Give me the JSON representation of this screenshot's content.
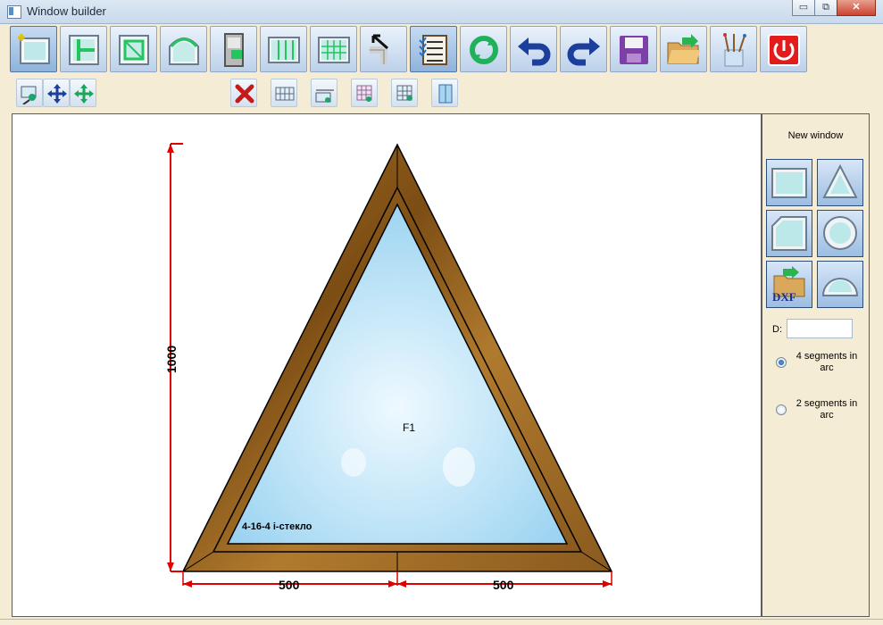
{
  "window": {
    "title": "Window builder",
    "minimize_glyph": "▭",
    "restore_glyph": "⧉",
    "close_glyph": "✕"
  },
  "toolbar_main": [
    {
      "name": "new-window-tool",
      "icon": "window-plus-icon",
      "active": true
    },
    {
      "name": "impost-tool",
      "icon": "impost-icon"
    },
    {
      "name": "sash-tool",
      "icon": "sash-icon"
    },
    {
      "name": "arc-tool",
      "icon": "arc-frame-icon"
    },
    {
      "name": "door-tool",
      "icon": "door-icon"
    },
    {
      "name": "vertical-division-tool",
      "icon": "vertical-split-icon"
    },
    {
      "name": "grid-division-tool",
      "icon": "grid-split-icon"
    },
    {
      "name": "connector-tool",
      "icon": "profile-connector-icon"
    },
    {
      "name": "properties-tool",
      "icon": "checklist-icon",
      "active": true
    },
    {
      "name": "refresh-tool",
      "icon": "refresh-icon"
    },
    {
      "name": "undo-tool",
      "icon": "undo-icon"
    },
    {
      "name": "redo-tool",
      "icon": "redo-icon"
    },
    {
      "name": "save-tool",
      "icon": "floppy-disk-icon"
    },
    {
      "name": "open-tool",
      "icon": "open-folder-icon"
    },
    {
      "name": "colors-tool",
      "icon": "brushes-icon"
    },
    {
      "name": "exit-tool",
      "icon": "power-icon"
    }
  ],
  "toolbar_secondary": [
    {
      "name": "zoom-tool",
      "icon": "zoom-icon"
    },
    {
      "name": "pan-tool",
      "icon": "move-arrows-icon"
    },
    {
      "name": "fit-tool",
      "icon": "fit-arrows-icon"
    },
    {
      "name": "delete-tool",
      "icon": "red-x-icon"
    },
    {
      "name": "glazing-bars-tool",
      "icon": "glazing-bars-icon"
    },
    {
      "name": "dimension-tool",
      "icon": "dimension-icon"
    },
    {
      "name": "mosquito-net-tool",
      "icon": "net-icon"
    },
    {
      "name": "net-search-tool",
      "icon": "net-search-icon"
    },
    {
      "name": "mirror-tool",
      "icon": "mirror-icon"
    }
  ],
  "drawing": {
    "frame_label": "F1",
    "glass_label": "4-16-4 i-стекло",
    "height_dim": "1000",
    "left_width_dim": "500",
    "right_width_dim": "500",
    "frame_color": "#8a5a1e",
    "glass_color": "#bfe4f7",
    "dim_color": "#e00000"
  },
  "side_panel": {
    "heading": "New window",
    "shapes": [
      {
        "name": "rectangle-shape-button",
        "icon": "rectangle-window-icon"
      },
      {
        "name": "triangle-shape-button",
        "icon": "triangle-window-icon"
      },
      {
        "name": "cut-corner-shape-button",
        "icon": "cut-corner-window-icon"
      },
      {
        "name": "circle-shape-button",
        "icon": "circle-window-icon"
      },
      {
        "name": "dxf-import-button",
        "icon": "dxf-import-icon",
        "text": "DXF"
      },
      {
        "name": "half-circle-shape-button",
        "icon": "half-circle-window-icon"
      }
    ],
    "d_label": "D:",
    "d_value": "",
    "radio_options": [
      {
        "label": "4 segments in arc",
        "checked": true
      },
      {
        "label": "2 segments in arc",
        "checked": false
      }
    ]
  }
}
